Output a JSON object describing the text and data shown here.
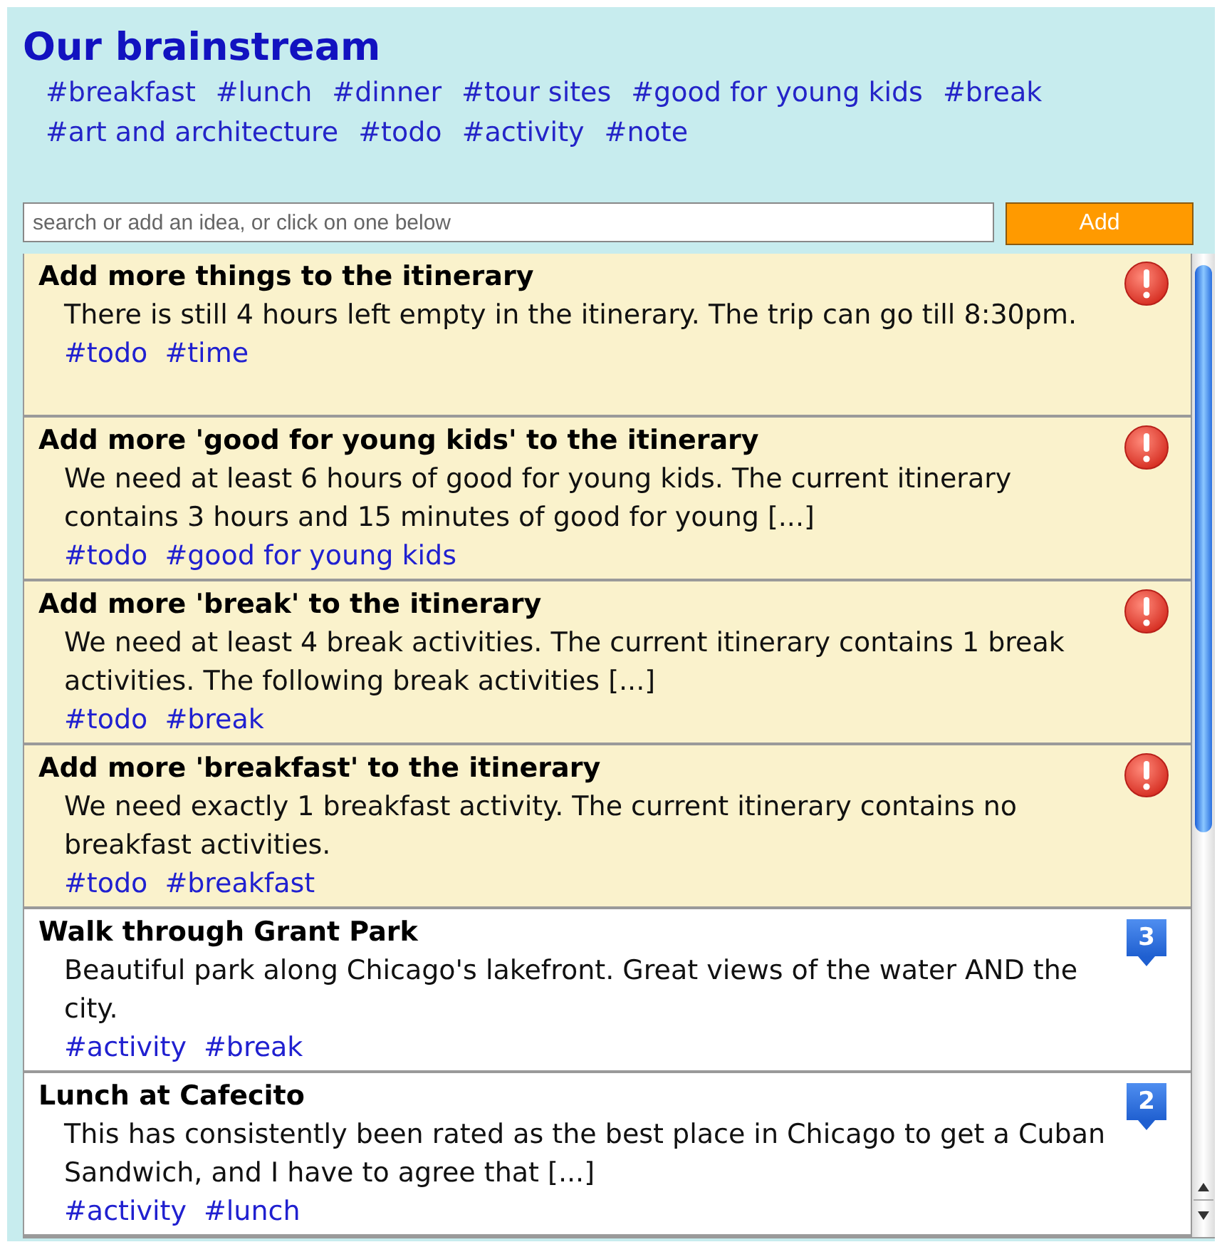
{
  "title": "Our brainstream",
  "tags": [
    "#breakfast",
    "#lunch",
    "#dinner",
    "#tour sites",
    "#good for young kids",
    "#break",
    "#art and architecture",
    "#todo",
    "#activity",
    "#note"
  ],
  "search": {
    "placeholder": "search or add an idea, or click on one below"
  },
  "add_button": "Add",
  "ideas": [
    {
      "kind": "alert",
      "title": "Add more things to the itinerary",
      "text": "There is still 4 hours left empty in the itinerary. The trip can go till 8:30pm.",
      "tags": [
        "#todo",
        "#time"
      ]
    },
    {
      "kind": "alert",
      "title": "Add more 'good for young kids' to the itinerary",
      "text": "We need at least 6 hours of good for young kids. The current itinerary contains 3 hours and 15 minutes of good for young [...]",
      "tags": [
        "#todo",
        "#good for young kids"
      ]
    },
    {
      "kind": "alert",
      "title": "Add more 'break' to the itinerary",
      "text": "We need at least 4 break activities. The current itinerary contains 1 break activities. The following break activities [...]",
      "tags": [
        "#todo",
        "#break"
      ]
    },
    {
      "kind": "alert",
      "title": "Add more 'breakfast' to the itinerary",
      "text": "We need exactly 1 breakfast activity. The current itinerary contains no breakfast activities.",
      "tags": [
        "#todo",
        "#breakfast"
      ]
    },
    {
      "kind": "idea",
      "title": "Walk through Grant Park",
      "text": "Beautiful park along Chicago's lakefront. Great views of the water AND the city.",
      "tags": [
        "#activity",
        "#break"
      ],
      "votes": "3"
    },
    {
      "kind": "idea",
      "title": "Lunch at Cafecito",
      "text": "This has consistently been rated as the best place in Chicago to get a Cuban Sandwich, and I have to agree that [...]",
      "tags": [
        "#activity",
        "#lunch"
      ],
      "votes": "2"
    }
  ]
}
